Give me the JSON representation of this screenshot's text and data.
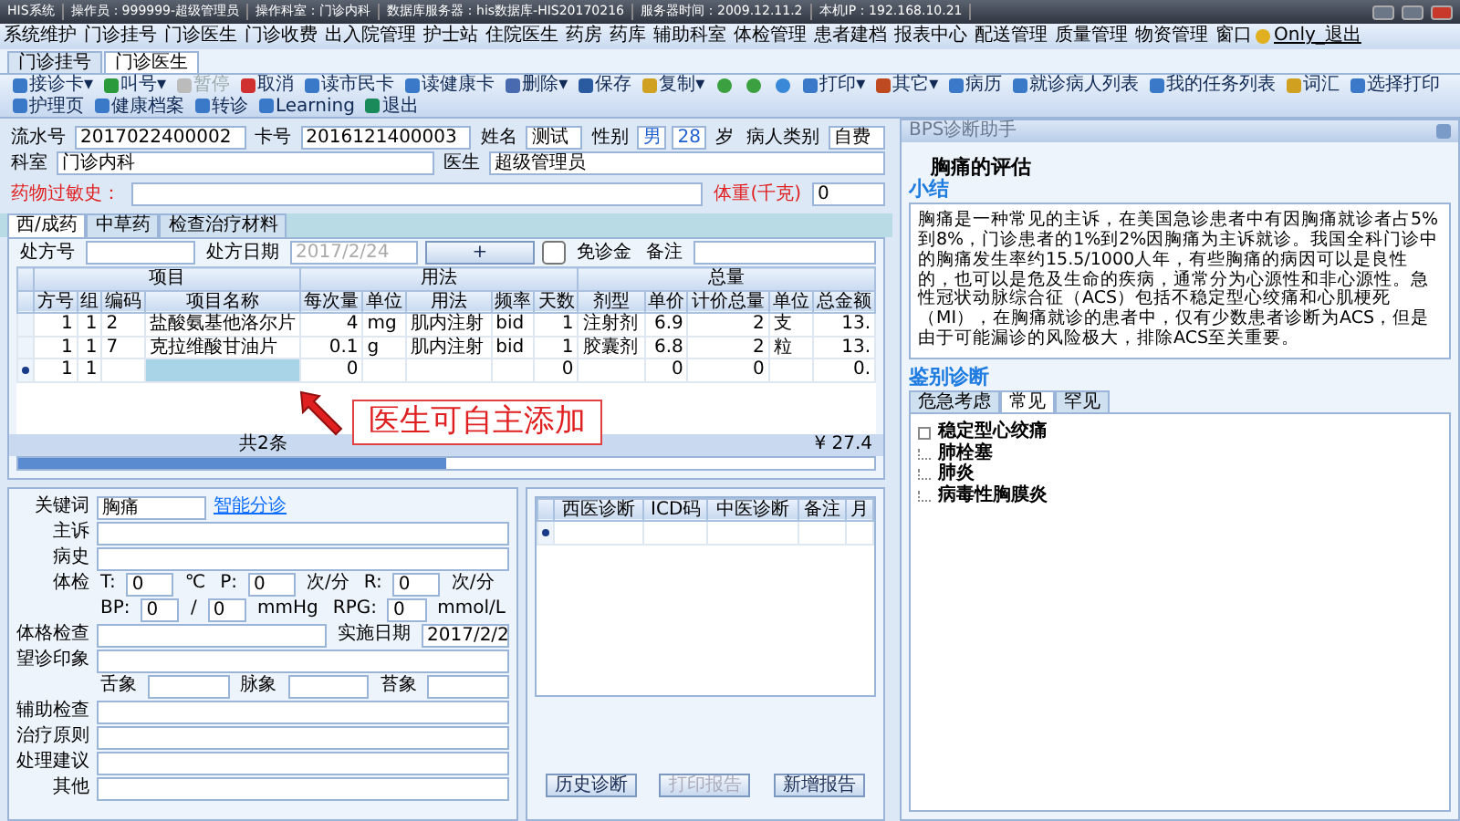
{
  "title_bar": [
    "HIS系统",
    "操作员：999999-超级管理员",
    "操作科室：门诊内科",
    "数据库服务器：his数据库-HIS20170216",
    "服务器时间：2009.12.11.2",
    "本机IP：192.168.10.21"
  ],
  "menu": [
    "系统维护",
    "门诊挂号",
    "门诊医生",
    "门诊收费",
    "出入院管理",
    "护士站",
    "住院医生",
    "药房",
    "药库",
    "辅助科室",
    "体检管理",
    "患者建档",
    "报表中心",
    "配送管理",
    "质量管理",
    "物资管理",
    "窗口",
    "Only_退出"
  ],
  "module_tabs": [
    {
      "label": "门诊挂号",
      "selected": false
    },
    {
      "label": "门诊医生",
      "selected": true
    }
  ],
  "toolbar": [
    {
      "kind": "button",
      "label": "接诊卡▾",
      "disabled": false
    },
    {
      "kind": "button",
      "label": "叫号▾",
      "disabled": false
    },
    {
      "kind": "button",
      "label": "暂停",
      "disabled": true
    },
    {
      "kind": "button",
      "label": "取消",
      "disabled": false
    },
    {
      "kind": "button",
      "label": "读市民卡",
      "disabled": false
    },
    {
      "kind": "button",
      "label": "读健康卡",
      "disabled": false
    },
    {
      "kind": "button",
      "label": "删除▾",
      "disabled": false
    },
    {
      "kind": "button",
      "label": "保存",
      "disabled": false
    },
    {
      "kind": "button",
      "label": "复制▾",
      "disabled": false
    },
    {
      "kind": "nav"
    },
    {
      "kind": "button",
      "label": "打印▾",
      "disabled": false
    },
    {
      "kind": "button",
      "label": "其它▾",
      "disabled": false
    },
    {
      "kind": "button",
      "label": "病历",
      "disabled": false
    },
    {
      "kind": "button",
      "label": "就诊病人列表",
      "disabled": false
    },
    {
      "kind": "button",
      "label": "我的任务列表",
      "disabled": false
    },
    {
      "kind": "button",
      "label": "词汇",
      "disabled": false
    },
    {
      "kind": "button",
      "label": "选择打印",
      "disabled": false
    },
    {
      "kind": "button",
      "label": "护理页",
      "disabled": false
    },
    {
      "kind": "button",
      "label": "健康档案",
      "disabled": false
    },
    {
      "kind": "button",
      "label": "转诊",
      "disabled": false
    },
    {
      "kind": "button",
      "label": "Learning",
      "disabled": false
    },
    {
      "kind": "button",
      "label": "退出",
      "disabled": false
    }
  ],
  "patient": [
    {
      "kind": "label",
      "text": "流水号"
    },
    {
      "kind": "field",
      "value": "2017022400002"
    },
    {
      "kind": "label",
      "text": "卡号"
    },
    {
      "kind": "field",
      "value": "2016121400003"
    },
    {
      "kind": "label",
      "text": "姓名"
    },
    {
      "kind": "field",
      "value": "测试"
    },
    {
      "kind": "label",
      "text": "性别"
    },
    {
      "kind": "short",
      "value": "男"
    },
    {
      "kind": "short",
      "value": "28"
    },
    {
      "kind": "label",
      "text": "岁"
    },
    {
      "kind": "label",
      "text": "病人类别"
    },
    {
      "kind": "field",
      "value": "自费"
    },
    {
      "kind": "label",
      "text": "科室"
    },
    {
      "kind": "field",
      "value": "门诊内科"
    },
    {
      "kind": "label",
      "text": "医生"
    },
    {
      "kind": "field",
      "value": "超级管理员"
    }
  ],
  "allergy": {
    "label": "药物过敏史："
  },
  "weight": {
    "label": "体重(千克)",
    "value": "0"
  },
  "rx_tabs": [
    {
      "label": "西/成药",
      "selected": true
    },
    {
      "label": "中草药",
      "selected": false
    },
    {
      "label": "检查治疗材料",
      "selected": false
    }
  ],
  "prescription_bar": {
    "rx_no_label": "处方号",
    "date_label": "处方日期",
    "date": "2017/2/24",
    "add_button": "+",
    "free_fee": {
      "label": "免诊金",
      "checked": false
    },
    "remark_label": "备注"
  },
  "rx_table": {
    "groups": [
      {
        "label": "项目",
        "columns": [
          "方号",
          "组",
          "编码",
          "项目名称"
        ]
      },
      {
        "label": "用法",
        "columns": [
          "每次量",
          "单位",
          "用法",
          "频率",
          "天数"
        ]
      },
      {
        "label": "总量",
        "columns": [
          "剂型",
          "单价",
          "计价总量",
          "单位",
          "总金额"
        ]
      }
    ],
    "rows": [
      {
        "current": false,
        "cells": [
          "1",
          "1",
          "2",
          "盐酸氨基他洛尔片",
          "4",
          "mg",
          "肌内注射",
          "bid",
          "1",
          "注射剂",
          "6.9",
          "2",
          "支",
          "13."
        ]
      },
      {
        "current": false,
        "cells": [
          "1",
          "1",
          "7",
          "克拉维酸甘油片",
          "0.1",
          "g",
          "肌内注射",
          "bid",
          "1",
          "胶囊剂",
          "6.8",
          "2",
          "粒",
          "13."
        ]
      },
      {
        "current": true,
        "cells": [
          "1",
          "1",
          "",
          "",
          "0",
          "",
          "",
          "",
          "0",
          "",
          "0",
          "0",
          "",
          "0."
        ]
      }
    ],
    "footer": {
      "count": "共2条",
      "total": "¥ 27.4"
    }
  },
  "callout": "医生可自主添加",
  "assistant": {
    "title": "BPS诊断助手",
    "heading": "胸痛的评估",
    "summary_label": "小结",
    "summary": "胸痛是一种常见的主诉，在美国急诊患者中有因胸痛就诊者占5%到8%，门诊患者的1%到2%因胸痛为主诉就诊。我国全科门诊中的胸痛发生率约15.5/1000人年，有些胸痛的病因可以是良性的，也可以是危及生命的疾病，通常分为心源性和非心源性。急性冠状动脉综合征（ACS）包括不稳定型心绞痛和心肌梗死（MI），在胸痛就诊的患者中，仅有少数患者诊断为ACS，但是由于可能漏诊的风险极大，排除ACS至关重要。",
    "differential_label": "鉴别诊断",
    "tabs": [
      {
        "label": "危急考虑",
        "selected": false
      },
      {
        "label": "常见",
        "selected": true
      },
      {
        "label": "罕见",
        "selected": false
      }
    ],
    "tree": [
      {
        "kind": "group",
        "label": "稳定型心绞痛"
      },
      {
        "kind": "leaf",
        "label": "肺栓塞"
      },
      {
        "kind": "leaf",
        "label": "肺炎"
      },
      {
        "kind": "leaf",
        "label": "病毒性胸膜炎"
      }
    ]
  },
  "exam_form": [
    [
      {
        "kind": "label",
        "text": "关键词"
      },
      {
        "kind": "field",
        "value": "胸痛"
      },
      {
        "kind": "link",
        "text": "智能分诊"
      }
    ],
    [
      {
        "kind": "label",
        "text": "主诉"
      },
      {
        "kind": "wide"
      }
    ],
    [
      {
        "kind": "label",
        "text": "病史"
      },
      {
        "kind": "wide"
      }
    ],
    [
      {
        "kind": "label",
        "text": "体检"
      },
      {
        "kind": "text",
        "text": "T:"
      },
      {
        "kind": "small",
        "value": "0"
      },
      {
        "kind": "text",
        "text": "℃"
      },
      {
        "kind": "text",
        "text": "P:"
      },
      {
        "kind": "small",
        "value": "0"
      },
      {
        "kind": "text",
        "text": "次/分"
      },
      {
        "kind": "text",
        "text": "R:"
      },
      {
        "kind": "small",
        "value": "0"
      },
      {
        "kind": "text",
        "text": "次/分"
      }
    ],
    [
      {
        "kind": "label"
      },
      {
        "kind": "text",
        "text": "BP:"
      },
      {
        "kind": "small",
        "value": "0"
      },
      {
        "kind": "text",
        "text": "/"
      },
      {
        "kind": "small",
        "value": "0"
      },
      {
        "kind": "text",
        "text": "mmHg"
      },
      {
        "kind": "text",
        "text": "RPG:"
      },
      {
        "kind": "small",
        "value": "0"
      },
      {
        "kind": "text",
        "text": "mmol/L"
      }
    ],
    [
      {
        "kind": "label",
        "text": "体格检查"
      },
      {
        "kind": "wide"
      },
      {
        "kind": "text",
        "text": "实施日期"
      },
      {
        "kind": "date",
        "value": "2017/2/2"
      }
    ],
    [
      {
        "kind": "label",
        "text": "望诊印象"
      },
      {
        "kind": "wide"
      }
    ],
    [
      {
        "kind": "label"
      },
      {
        "kind": "text",
        "text": "舌象"
      },
      {
        "kind": "wide"
      },
      {
        "kind": "text",
        "text": "脉象"
      },
      {
        "kind": "wide"
      },
      {
        "kind": "text",
        "text": "苔象"
      },
      {
        "kind": "wide"
      }
    ],
    [
      {
        "kind": "label",
        "text": "辅助检查"
      },
      {
        "kind": "wide"
      }
    ],
    [
      {
        "kind": "label",
        "text": "治疗原则"
      },
      {
        "kind": "wide"
      }
    ],
    [
      {
        "kind": "label",
        "text": "处理建议"
      },
      {
        "kind": "wide"
      }
    ],
    [
      {
        "kind": "label",
        "text": "其他"
      },
      {
        "kind": "wide"
      }
    ]
  ],
  "diagnosis": {
    "columns": [
      "西医诊断",
      "ICD码",
      "中医诊断",
      "备注",
      "月"
    ],
    "buttons": [
      {
        "label": "历史诊断",
        "disabled": false
      },
      {
        "label": "打印报告",
        "disabled": true
      },
      {
        "label": "新增报告",
        "disabled": false
      }
    ]
  }
}
